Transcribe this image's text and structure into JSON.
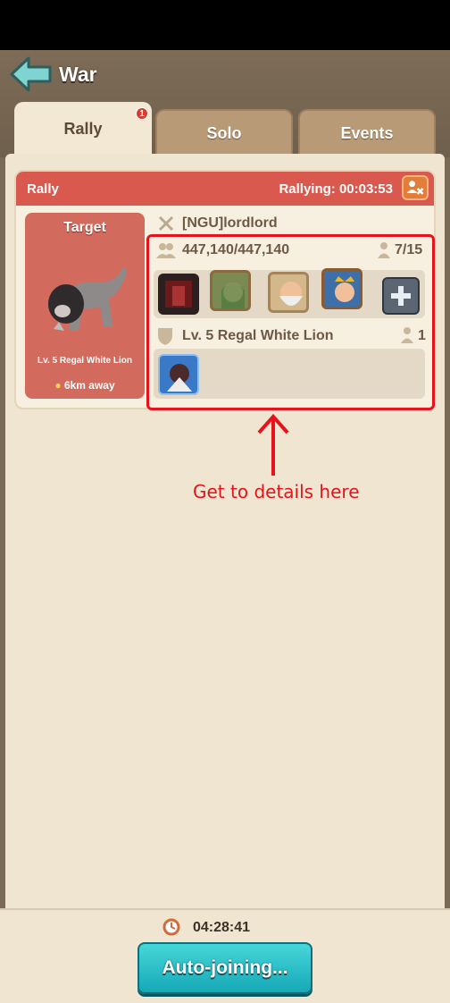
{
  "header": {
    "title": "War",
    "back_icon": "back-arrow-icon"
  },
  "tabs": [
    {
      "label": "Rally",
      "badge": "1",
      "active": true
    },
    {
      "label": "Solo",
      "active": false
    },
    {
      "label": "Events",
      "active": false
    }
  ],
  "rally_card": {
    "header_label": "Rally",
    "rallying_text": "Rallying: 00:03:53",
    "target": {
      "title": "Target",
      "name": "Lv. 5 Regal White Lion",
      "distance": "6km away"
    },
    "leader": "[NGU]lordlord",
    "troops": "447,140/447,140",
    "members": "7/15",
    "defender_name": "Lv. 5 Regal White Lion",
    "defender_count": "1"
  },
  "annotation": {
    "text": "Get to details here",
    "color": "#e8121a"
  },
  "footer": {
    "countdown": "04:28:41",
    "button_label": "Auto-joining..."
  },
  "colors": {
    "header_red": "#d9594e",
    "button_teal": "#1fb5c2",
    "panel_bg": "#efe5d0"
  }
}
